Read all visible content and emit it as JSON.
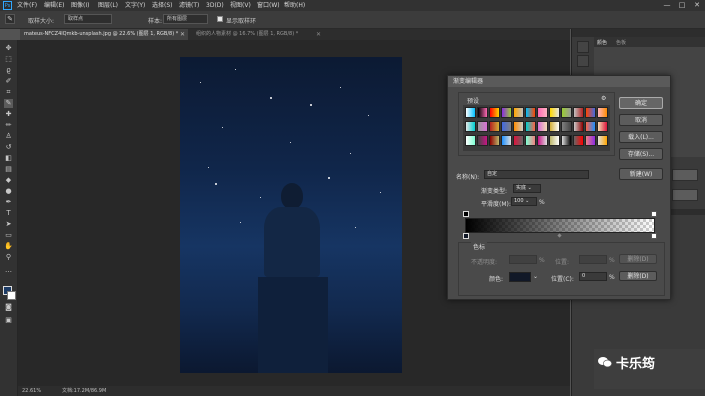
{
  "menubar": {
    "logo": "Ps",
    "items": [
      "文件(F)",
      "编辑(E)",
      "图像(I)",
      "图层(L)",
      "文字(Y)",
      "选择(S)",
      "滤镜(T)",
      "3D(D)",
      "视图(V)",
      "窗口(W)",
      "帮助(H)"
    ],
    "window_controls": [
      "—",
      "□",
      "✕"
    ]
  },
  "options_bar": {
    "sample_size_label": "取样大小:",
    "sample_size_value": "取样点",
    "sample_label": "样本:",
    "sample_value": "所有图层",
    "show_ring_label": "显示取样环"
  },
  "tabs": [
    {
      "label": "mateus-NFCZ4lQmkb-unsplash.jpg @ 22.6% (图层 1, RGB/8) *",
      "active": true
    },
    {
      "label": "组织的人物素材 @ 16.7% (图层 1, RGB/8) *",
      "active": false
    }
  ],
  "status": {
    "zoom": "22.61%",
    "doc": "文档:17.2M/86.9M"
  },
  "right_panel": {
    "tabs": [
      "颜色",
      "色板"
    ]
  },
  "dialog": {
    "title": "渐变编辑器",
    "presets_label": "预设",
    "ok": "确定",
    "cancel": "取消",
    "load": "载入(L)...",
    "save": "存储(S)...",
    "name_label": "名称(N):",
    "name_value": "自定",
    "new_button": "新建(W)",
    "gradient_type_label": "渐变类型:",
    "gradient_type_value": "实底",
    "smoothness_label": "平滑度(M):",
    "smoothness_value": "100",
    "smoothness_unit": "%",
    "stops_section": "色标",
    "opacity_label": "不透明度:",
    "opacity_unit": "%",
    "location_label": "位置:",
    "delete_label": "删除(D)",
    "color_label": "颜色:",
    "color_location_label": "位置(C):",
    "color_location_value": "0",
    "color_location_unit": "%",
    "color_delete": "删除(D)",
    "stop_color": "#111827",
    "preset_colors": [
      "#ffffff",
      "#000000",
      "#ff0000",
      "#8a2be2",
      "#ffa500",
      "#00bfff",
      "#ff69b4",
      "#ffd700",
      "#9acd32",
      "#c0c0c0",
      "#ff4500",
      "#ffb6c1",
      "#e6e6e6",
      "#999999",
      "#b22222",
      "#4169e1",
      "#ff8c00",
      "#00ced1",
      "#da70d6",
      "#d4af37",
      "#808080",
      "#cccccc",
      "#ff6347",
      "#f5deb3",
      "#ffffff",
      "#444444",
      "#8b0000",
      "#1e90ff",
      "#dc143c",
      "#7fffd4",
      "#c71585",
      "#bdb76b",
      "#dddddd",
      "#666666",
      "#f08080",
      "#e0e0e0"
    ]
  },
  "watermark": {
    "text": "卡乐筠"
  }
}
